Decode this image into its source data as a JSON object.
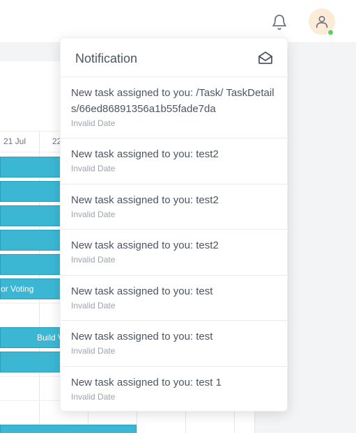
{
  "gantt": {
    "days": [
      "21 Jul",
      "22"
    ],
    "bar_labels": [
      "or Voting",
      "Build V"
    ]
  },
  "dropdown": {
    "title": "Notification",
    "icon": "mail-open-icon",
    "items": [
      {
        "message": "New task assigned to you: /Task/ TaskDetails/66ed86891356a1b55fade7da",
        "date": "Invalid Date"
      },
      {
        "message": "New task assigned to you: test2",
        "date": "Invalid Date"
      },
      {
        "message": "New task assigned to you: test2",
        "date": "Invalid Date"
      },
      {
        "message": "New task assigned to you: test2",
        "date": "Invalid Date"
      },
      {
        "message": "New task assigned to you: test",
        "date": "Invalid Date"
      },
      {
        "message": "New task assigned to you: test",
        "date": "Invalid Date"
      },
      {
        "message": "New task assigned to you: test 1",
        "date": "Invalid Date"
      }
    ]
  },
  "header": {
    "icons": [
      "bell-icon",
      "user-icon"
    ],
    "status_color": "#5ad05a"
  }
}
